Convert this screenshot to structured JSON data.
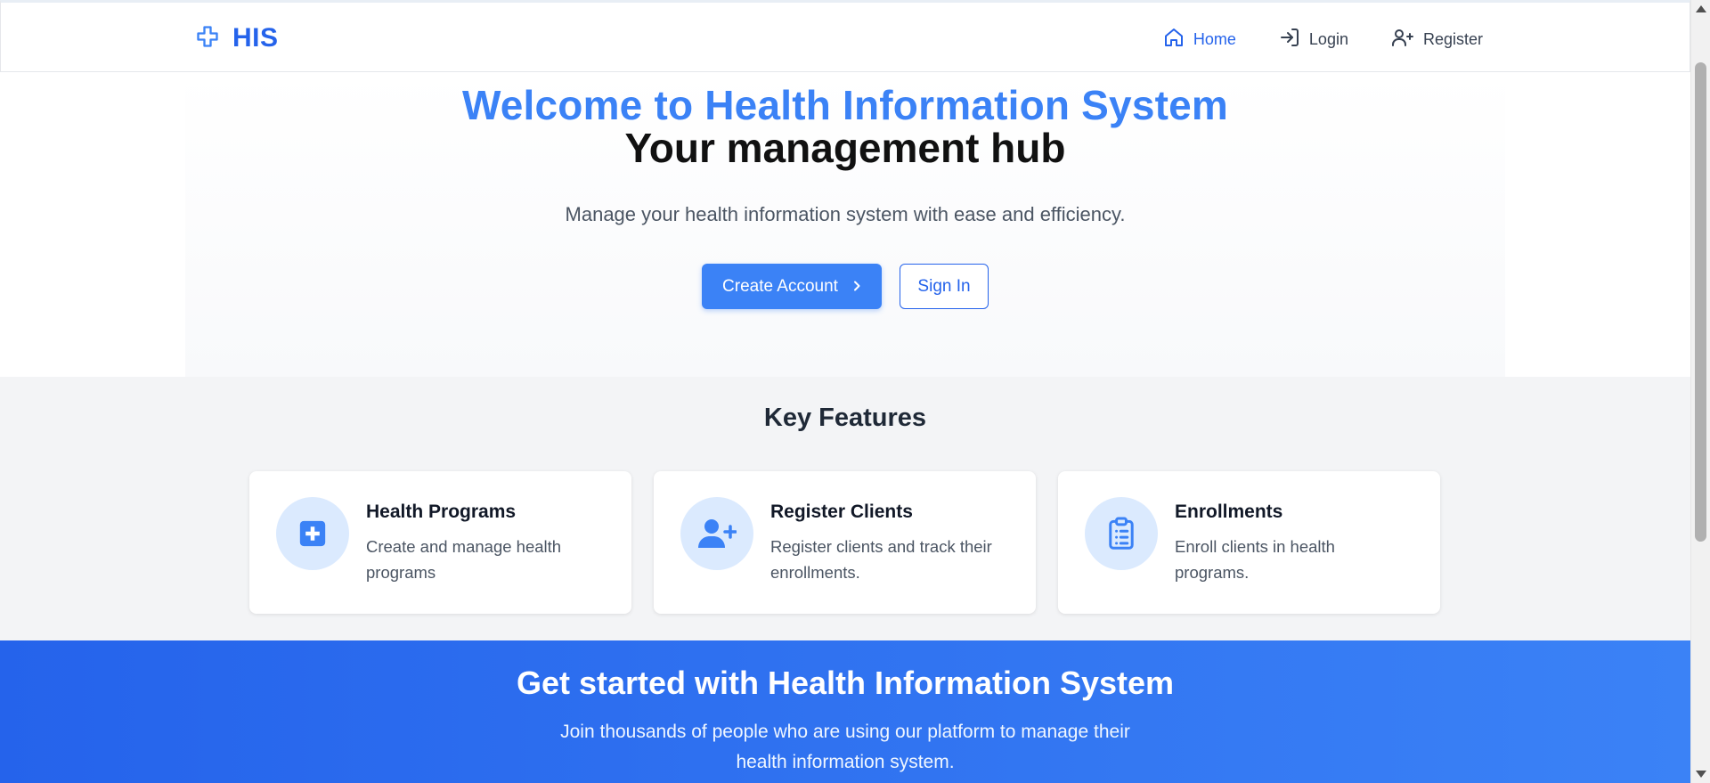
{
  "navbar": {
    "brand": "HIS",
    "links": [
      {
        "label": "Home",
        "icon": "home-icon",
        "active": true
      },
      {
        "label": "Login",
        "icon": "login-icon",
        "active": false
      },
      {
        "label": "Register",
        "icon": "user-plus-icon",
        "active": false
      }
    ]
  },
  "hero": {
    "title": "Welcome to Health Information System",
    "subtitle": "Your management hub",
    "description": "Manage your health information system with ease and efficiency.",
    "primary_button": "Create Account",
    "secondary_button": "Sign In"
  },
  "features": {
    "title": "Key Features",
    "items": [
      {
        "title": "Health Programs",
        "description": "Create and manage health programs",
        "icon": "medical-plus-icon"
      },
      {
        "title": "Register Clients",
        "description": "Register clients and track their enrollments.",
        "icon": "user-plus-icon"
      },
      {
        "title": "Enrollments",
        "description": "Enroll clients in health programs.",
        "icon": "clipboard-list-icon"
      }
    ]
  },
  "cta": {
    "title": "Get started with Health Information System",
    "description": "Join thousands of people who are using our platform to manage their health information system."
  },
  "colors": {
    "primary": "#3b82f6",
    "primary_dark": "#2563eb",
    "icon_bg": "#dbeafe",
    "section_bg": "#f3f4f6"
  }
}
